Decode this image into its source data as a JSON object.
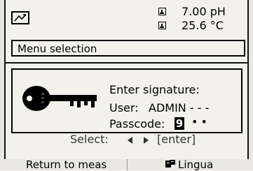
{
  "header": {
    "mode_icon": "measurement-mode-icon",
    "readings": [
      {
        "icon": "sensor-icon",
        "value": "7.00 pH"
      },
      {
        "icon": "sensor-icon",
        "value": "25.6 °C"
      }
    ]
  },
  "menu_bar": {
    "label": "Menu selection"
  },
  "background_hint": {
    "select_label": "Select:",
    "enter_label": "[enter]"
  },
  "dialog": {
    "icon": "key-icon",
    "title": "Enter signature:",
    "user_label": "User:",
    "user_value": "ADMIN - - -",
    "passcode_label": "Passcode:",
    "passcode_digit": "9",
    "passcode_masked": "••"
  },
  "softkeys": {
    "left": "Return to meas",
    "right": "Lingua",
    "right_icon": "language-icon"
  }
}
